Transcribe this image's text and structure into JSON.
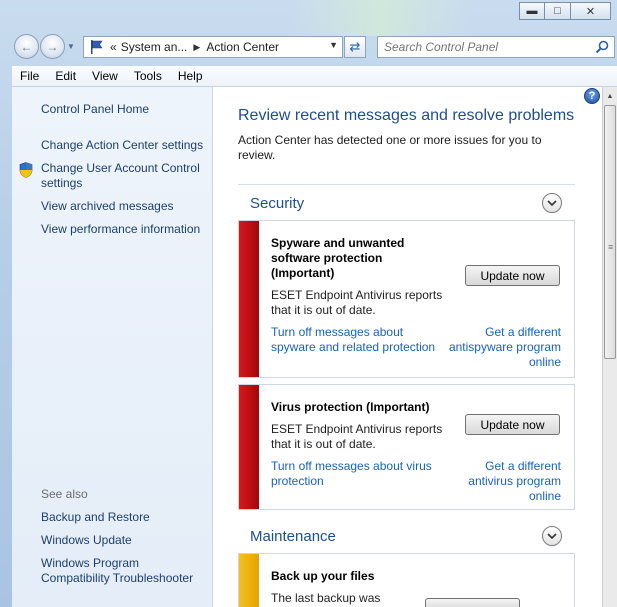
{
  "window": {
    "caption_min": "▭",
    "caption_max": "◻",
    "caption_close": "✕"
  },
  "address": {
    "history": "«",
    "crumb1": "System an...",
    "crumb2": "Action Center"
  },
  "search": {
    "placeholder": "Search Control Panel"
  },
  "menu": [
    "File",
    "Edit",
    "View",
    "Tools",
    "Help"
  ],
  "left_nav": {
    "home": "Control Panel Home",
    "links": [
      "Change Action Center settings",
      "Change User Account Control settings",
      "View archived messages",
      "View performance information"
    ],
    "see_also_label": "See also",
    "see_also": [
      "Backup and Restore",
      "Windows Update",
      "Windows Program Compatibility Troubleshooter"
    ]
  },
  "main": {
    "title": "Review recent messages and resolve problems",
    "intro": "Action Center has detected one or more issues for you to review.",
    "help": "?",
    "security_heading": "Security",
    "maintenance_heading": "Maintenance",
    "cards": [
      {
        "title": "Spyware and unwanted software protection (Important)",
        "body": "ESET Endpoint Antivirus reports that it is out of date.",
        "button": "Update now",
        "link_left": "Turn off messages about spyware and related protection",
        "link_right": "Get a different antispyware program online",
        "color": "#c0090e"
      },
      {
        "title": "Virus protection  (Important)",
        "body": "ESET Endpoint Antivirus reports that it is out of date.",
        "button": "Update now",
        "link_left": "Turn off messages about virus protection",
        "link_right": "Get a different antivirus program online",
        "color": "#c0090e"
      },
      {
        "title": "Back up your files",
        "body": "The last backup was",
        "color": "#f0b400"
      }
    ]
  }
}
